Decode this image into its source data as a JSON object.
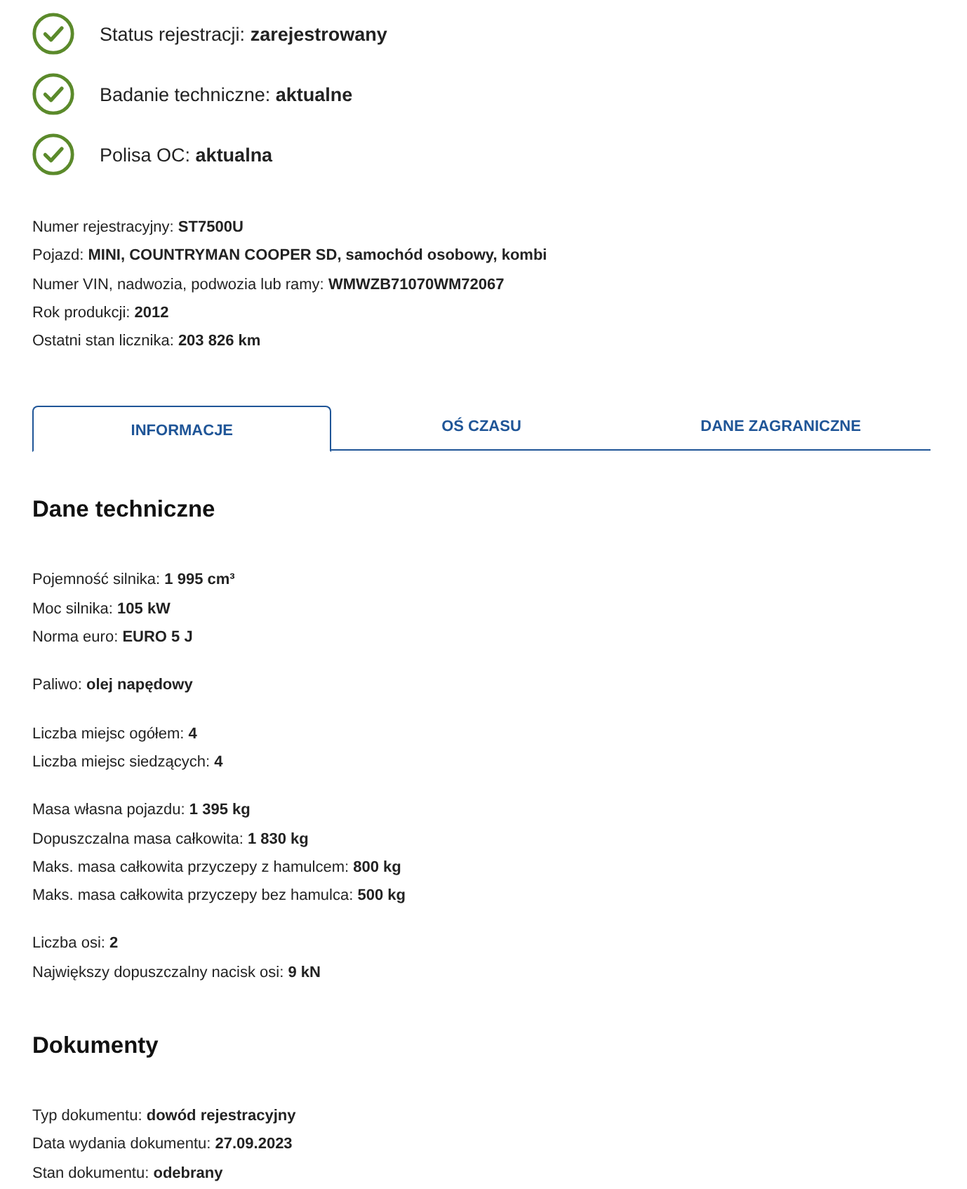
{
  "status": [
    {
      "label": "Status rejestracji:",
      "value": "zarejestrowany"
    },
    {
      "label": "Badanie techniczne:",
      "value": "aktualne"
    },
    {
      "label": "Polisa OC:",
      "value": "aktualna"
    }
  ],
  "vehicle": [
    {
      "label": "Numer rejestracyjny:",
      "value": "ST7500U"
    },
    {
      "label": "Pojazd:",
      "value": "MINI, COUNTRYMAN COOPER SD, samochód osobowy, kombi"
    },
    {
      "label": "Numer VIN, nadwozia, podwozia lub ramy:",
      "value": "WMWZB71070WM72067"
    },
    {
      "label": "Rok produkcji:",
      "value": "2012"
    },
    {
      "label": "Ostatni stan licznika:",
      "value": "203 826 km"
    }
  ],
  "tabs": [
    {
      "label": "INFORMACJE",
      "selected": true
    },
    {
      "label": "OŚ CZASU",
      "selected": false
    },
    {
      "label": "DANE ZAGRANICZNE",
      "selected": false
    }
  ],
  "sections": [
    {
      "title": "Dane techniczne",
      "groups": [
        [
          {
            "label": "Pojemność silnika:",
            "value": "1 995 cm³"
          },
          {
            "label": "Moc silnika:",
            "value": "105 kW"
          },
          {
            "label": "Norma euro:",
            "value": "EURO 5 J"
          }
        ],
        [
          {
            "label": "Paliwo:",
            "value": "olej napędowy"
          }
        ],
        [
          {
            "label": "Liczba miejsc ogółem:",
            "value": "4"
          },
          {
            "label": "Liczba miejsc siedzących:",
            "value": "4"
          }
        ],
        [
          {
            "label": "Masa własna pojazdu:",
            "value": "1 395 kg"
          },
          {
            "label": "Dopuszczalna masa całkowita:",
            "value": "1 830 kg"
          },
          {
            "label": "Maks. masa całkowita przyczepy z hamulcem:",
            "value": "800 kg"
          },
          {
            "label": "Maks. masa całkowita przyczepy bez hamulca:",
            "value": "500 kg"
          }
        ],
        [
          {
            "label": "Liczba osi:",
            "value": "2"
          },
          {
            "label": "Największy dopuszczalny nacisk osi:",
            "value": "9 kN"
          }
        ]
      ]
    },
    {
      "title": "Dokumenty",
      "groups": [
        [
          {
            "label": "Typ dokumentu:",
            "value": "dowód rejestracyjny"
          },
          {
            "label": "Data wydania dokumentu:",
            "value": "27.09.2023"
          },
          {
            "label": "Stan dokumentu:",
            "value": "odebrany"
          }
        ]
      ]
    }
  ]
}
